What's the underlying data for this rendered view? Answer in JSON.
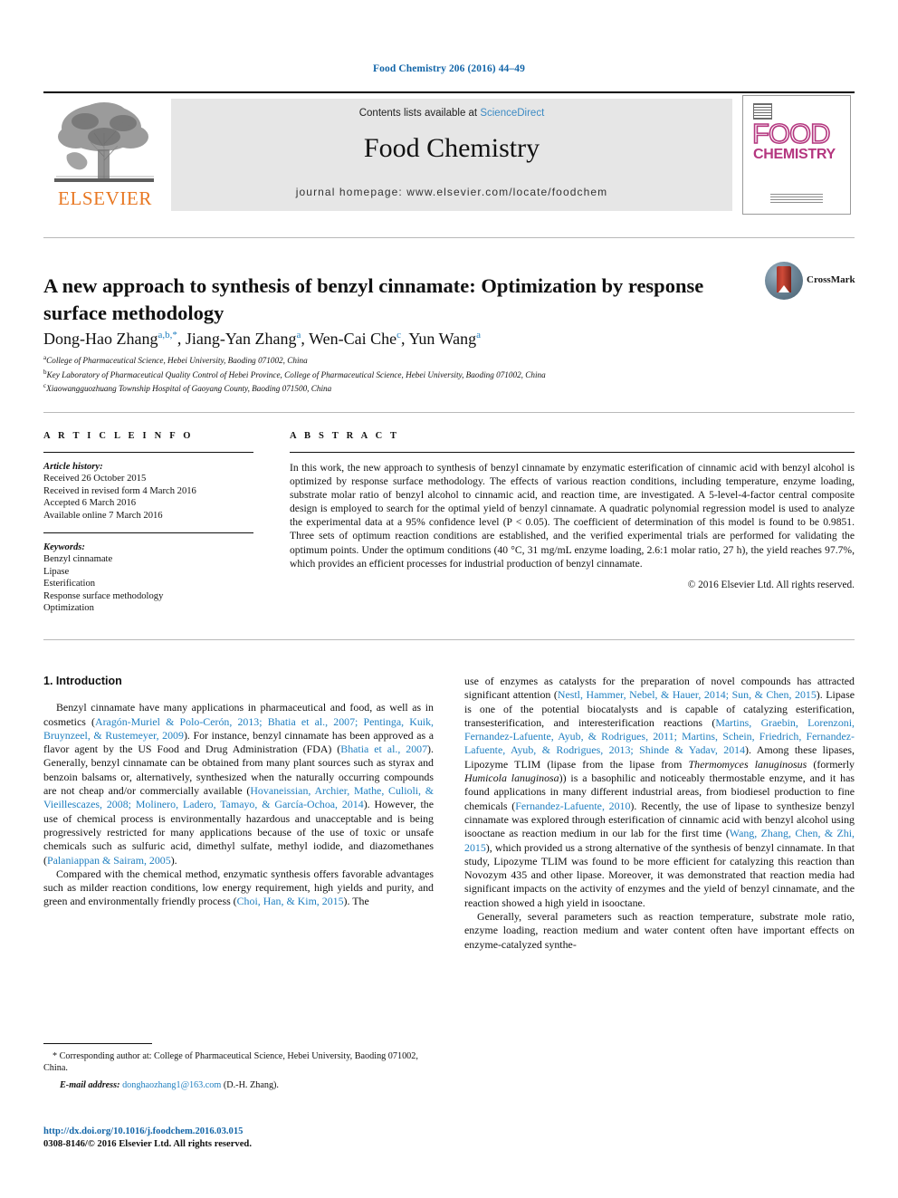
{
  "running_head": "Food Chemistry 206 (2016) 44–49",
  "masthead": {
    "contents_prefix": "Contents lists available at ",
    "sciencedirect": "ScienceDirect",
    "journal_title": "Food Chemistry",
    "homepage": "journal homepage: www.elsevier.com/locate/foodchem",
    "publisher_logo_text": "ELSEVIER",
    "cover": {
      "line1": "FOOD",
      "line2": "CHEMISTRY"
    },
    "accent_color": "#3d8bc4",
    "elsevier_orange": "#e87722",
    "cover_magenta": "#b4367f"
  },
  "title": "A new approach to synthesis of benzyl cinnamate: Optimization by response surface methodology",
  "crossmark_label": "CrossMark",
  "authors_html": "Dong-Hao Zhang<sup>a,b,</sup><sup>*</sup>, Jiang-Yan Zhang<sup>a</sup>, Wen-Cai Che<sup>c</sup>, Yun Wang<sup>a</sup>",
  "affiliations": [
    {
      "mark": "a",
      "text": "College of Pharmaceutical Science, Hebei University, Baoding 071002, China"
    },
    {
      "mark": "b",
      "text": "Key Laboratory of Pharmaceutical Quality Control of Hebei Province, College of Pharmaceutical Science, Hebei University, Baoding 071002, China"
    },
    {
      "mark": "c",
      "text": "Xiaowangguozhuang Township Hospital of Gaoyang County, Baoding 071500, China"
    }
  ],
  "article_info": {
    "heading": "A R T I C L E   I N F O",
    "history_label": "Article history:",
    "history": [
      "Received 26 October 2015",
      "Received in revised form 4 March 2016",
      "Accepted 6 March 2016",
      "Available online 7 March 2016"
    ],
    "keywords_label": "Keywords:",
    "keywords": [
      "Benzyl cinnamate",
      "Lipase",
      "Esterification",
      "Response surface methodology",
      "Optimization"
    ]
  },
  "abstract": {
    "heading": "A B S T R A C T",
    "text": "In this work, the new approach to synthesis of benzyl cinnamate by enzymatic esterification of cinnamic acid with benzyl alcohol is optimized by response surface methodology. The effects of various reaction conditions, including temperature, enzyme loading, substrate molar ratio of benzyl alcohol to cinnamic acid, and reaction time, are investigated. A 5-level-4-factor central composite design is employed to search for the optimal yield of benzyl cinnamate. A quadratic polynomial regression model is used to analyze the experimental data at a 95% confidence level (P < 0.05). The coefficient of determination of this model is found to be 0.9851. Three sets of optimum reaction conditions are established, and the verified experimental trials are performed for validating the optimum points. Under the optimum conditions (40 °C, 31 mg/mL enzyme loading, 2.6:1 molar ratio, 27 h), the yield reaches 97.7%, which provides an efficient processes for industrial production of benzyl cinnamate.",
    "copyright": "© 2016 Elsevier Ltd. All rights reserved."
  },
  "body": {
    "section_heading": "1. Introduction",
    "left_paragraph_1_html": "Benzyl cinnamate have many applications in pharmaceutical and food, as well as in cosmetics (<span class=\"ref\">Aragón-Muriel &amp; Polo-Cerón, 2013; Bhatia et al., 2007; Pentinga, Kuik, Bruynzeel, &amp; Rustemeyer, 2009</span>). For instance, benzyl cinnamate has been approved as a flavor agent by the US Food and Drug Administration (FDA) (<span class=\"ref\">Bhatia et al., 2007</span>). Generally, benzyl cinnamate can be obtained from many plant sources such as styrax and benzoin balsams or, alternatively, synthesized when the naturally occurring compounds are not cheap and/or commercially available (<span class=\"ref\">Hovaneissian, Archier, Mathe, Culioli, &amp; Vieillescazes, 2008; Molinero, Ladero, Tamayo, &amp; García-Ochoa, 2014</span>). However, the use of chemical process is environmentally hazardous and unacceptable and is being progressively restricted for many applications because of the use of toxic or unsafe chemicals such as sulfuric acid, dimethyl sulfate, methyl iodide, and diazomethanes (<span class=\"ref\">Palaniappan &amp; Sairam, 2005</span>).",
    "left_paragraph_2_html": "Compared with the chemical method, enzymatic synthesis offers favorable advantages such as milder reaction conditions, low energy requirement, high yields and purity, and green and environmentally friendly process (<span class=\"ref\">Choi, Han, &amp; Kim, 2015</span>). The",
    "right_paragraph_1_html": "use of enzymes as catalysts for the preparation of novel compounds has attracted significant attention (<span class=\"ref\">Nestl, Hammer, Nebel, &amp; Hauer, 2014; Sun, &amp; Chen, 2015</span>). Lipase is one of the potential biocatalysts and is capable of catalyzing esterification, transesterification, and interesterification reactions (<span class=\"ref\">Martins, Graebin, Lorenzoni, Fernandez-Lafuente, Ayub, &amp; Rodrigues, 2011; Martins, Schein, Friedrich, Fernandez-Lafuente, Ayub, &amp; Rodrigues, 2013; Shinde &amp; Yadav, 2014</span>). Among these lipases, Lipozyme TLIM (lipase from the lipase from <span class=\"it\">Thermomyces lanuginosus</span> (formerly <span class=\"it\">Humicola lanuginosa</span>)) is a basophilic and noticeably thermostable enzyme, and it has found applications in many different industrial areas, from biodiesel production to fine chemicals (<span class=\"ref\">Fernandez-Lafuente, 2010</span>). Recently, the use of lipase to synthesize benzyl cinnamate was explored through esterification of cinnamic acid with benzyl alcohol using isooctane as reaction medium in our lab for the first time (<span class=\"ref\">Wang, Zhang, Chen, &amp; Zhi, 2015</span>), which provided us a strong alternative of the synthesis of benzyl cinnamate. In that study, Lipozyme TLIM was found to be more efficient for catalyzing this reaction than Novozym 435 and other lipase. Moreover, it was demonstrated that reaction media had significant impacts on the activity of enzymes and the yield of benzyl cinnamate, and the reaction showed a high yield in isooctane.",
    "right_paragraph_2_html": "Generally, several parameters such as reaction temperature, substrate mole ratio, enzyme loading, reaction medium and water content often have important effects on enzyme-catalyzed synthe-"
  },
  "footnotes": {
    "corresponding": "* Corresponding author at: College of Pharmaceutical Science, Hebei University, Baoding 071002, China.",
    "email_label": "E-mail address:",
    "email": "donghaozhang1@163.com",
    "email_owner": "(D.-H. Zhang)."
  },
  "footer": {
    "doi": "http://dx.doi.org/10.1016/j.foodchem.2016.03.015",
    "issn_line": "0308-8146/© 2016 Elsevier Ltd. All rights reserved."
  }
}
